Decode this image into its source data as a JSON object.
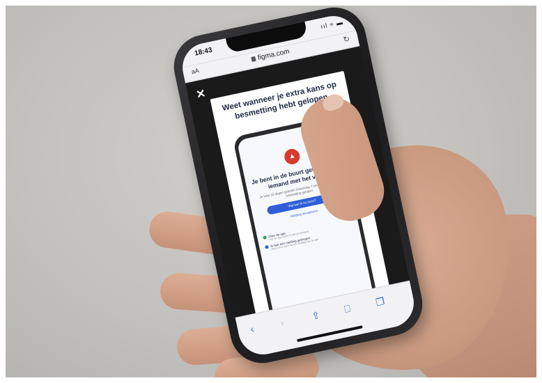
{
  "status_bar": {
    "time": "18:43",
    "signal": "ııl ≈ ▬"
  },
  "browser": {
    "text_size_label": "aA",
    "url": "figma.com",
    "lock_icon": "lock-icon",
    "reload_icon": "reload-icon"
  },
  "prototype": {
    "close_label": "✕",
    "title": "Weet wanneer je extra kans op besmetting hebt gelopen",
    "inner": {
      "alert_glyph": "▲",
      "title": "Je bent in de buurt geweest van iemand met het virus",
      "body": "Je hebt 10 dagen geleden (maandag 7 juni) extra kans op besmetting gelopen.",
      "primary_button": "Wat kan ik nu doen?",
      "secondary_link": "Melding verwijderen",
      "list": [
        {
          "label": "Over de app",
          "sub": "Hoe de app werkt en wat dit betekent.",
          "color": "#2e9e5b"
        },
        {
          "label": "Ik heb een melding gekregen",
          "sub": "Wat je kunt doen na een melding van de app.",
          "color": "#2f5fd8"
        }
      ]
    }
  },
  "toolbar": {
    "back": "‹",
    "forward": "›",
    "share": "⇧",
    "bookmarks": "⎕",
    "tabs": "❐"
  }
}
